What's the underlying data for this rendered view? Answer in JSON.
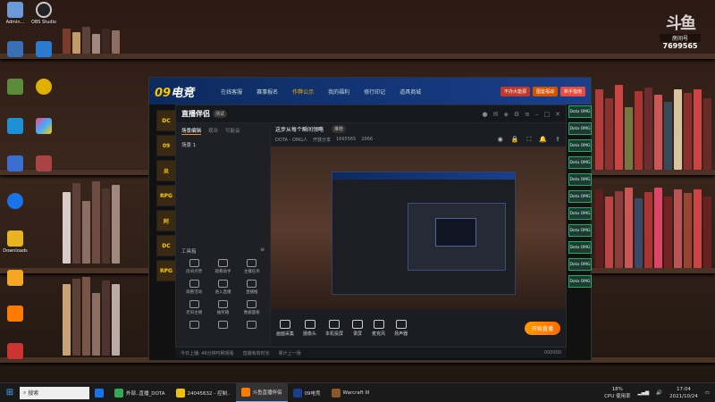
{
  "desktop": {
    "icons": [
      {
        "label": "Admin...",
        "color": "#6a9bd8"
      },
      {
        "label": "OBS Studio",
        "color": "#222"
      },
      {
        "label": "",
        "color": "#3b6fb5"
      },
      {
        "label": "",
        "color": "#2a7ad0"
      },
      {
        "label": "",
        "color": "#5a8c3a"
      },
      {
        "label": "",
        "color": "#e0b000"
      },
      {
        "label": "",
        "color": "#1f8fd6"
      },
      {
        "label": "",
        "color": "#ea4c89"
      },
      {
        "label": "",
        "color": "#3a6fd0"
      },
      {
        "label": "",
        "color": "#a44"
      },
      {
        "label": "",
        "color": "#1a73e8"
      },
      {
        "label": "Downloads",
        "color": "#e6b422"
      },
      {
        "label": "",
        "color": "#f5a623"
      },
      {
        "label": "",
        "color": "#ff7a00"
      },
      {
        "label": "",
        "color": "#c33"
      }
    ]
  },
  "badge": {
    "logo": "斗鱼",
    "room_label": "房间号",
    "room_number": "7699565"
  },
  "app09": {
    "brand_prefix": "09",
    "brand_suffix": "电竞",
    "nav": [
      "在线客服",
      "赛事报名",
      "作弊公示",
      "我的福利",
      "修行印记",
      "道具商城"
    ],
    "active_nav": 2,
    "pills": [
      {
        "label": "不办大能源",
        "color": "#c0392b"
      },
      {
        "label": "图鉴视战",
        "color": "#d35400"
      },
      {
        "label": "新手指南",
        "color": "#e74c3c"
      }
    ],
    "games": [
      "DC",
      "09",
      "炎",
      "RPG",
      "阿",
      "DC",
      "RPG"
    ]
  },
  "companion": {
    "title": "直播伴侣",
    "version_tag": "测试",
    "subtitle": "这步从每个瞬间领略",
    "subtitle_tag": "推荐",
    "tabs": [
      "场景编辑",
      "观众",
      "可能会"
    ],
    "scene": "场景 1",
    "meta": [
      "DOTA - OMG人",
      "开放分享",
      "1665565",
      "2666"
    ],
    "tools_title": "工具箱",
    "tools": [
      "房间点赞",
      "观看助手",
      "主播任务",
      "观看活动",
      "进入直播",
      "直播推",
      "老旧主播",
      "抽奖箱",
      "数据面板",
      "",
      "",
      ""
    ],
    "bottom_buttons": [
      "画面采集",
      "摄像头",
      "本机投屏",
      "录屏",
      "麦克风",
      "扬声器"
    ],
    "start_button": "开始直播",
    "status": [
      "今日上播: 46分钟可刷观看",
      "直播有效时长",
      "累计上一场",
      "000000"
    ]
  },
  "ticker": [
    "Dota OMG",
    "Dota OMG",
    "Dota OMG",
    "Dota OMG",
    "Dota OMG",
    "Dota OMG",
    "Dota OMG",
    "Dota OMG",
    "Dota OMG",
    "Dota OMG",
    "Dota OMG"
  ],
  "taskbar": {
    "search_placeholder": "搜索",
    "items": [
      {
        "label": "",
        "color": "#1a73e8",
        "active": false
      },
      {
        "label": "外部..直播_DOTA",
        "color": "#34a853",
        "active": false
      },
      {
        "label": "24045632 - 控制..",
        "color": "#f2c200",
        "active": false
      },
      {
        "label": "斗鱼直播伴侣",
        "color": "#ff7a00",
        "active": true
      },
      {
        "label": "09电竞",
        "color": "#1a3f8c",
        "active": false
      },
      {
        "label": "Warcraft III",
        "color": "#8b5a2b",
        "active": false
      }
    ],
    "tray": {
      "cpu": "18%",
      "cpu_label": "CPU 使用率",
      "time": "17:04",
      "date": "2021/10/24"
    }
  }
}
